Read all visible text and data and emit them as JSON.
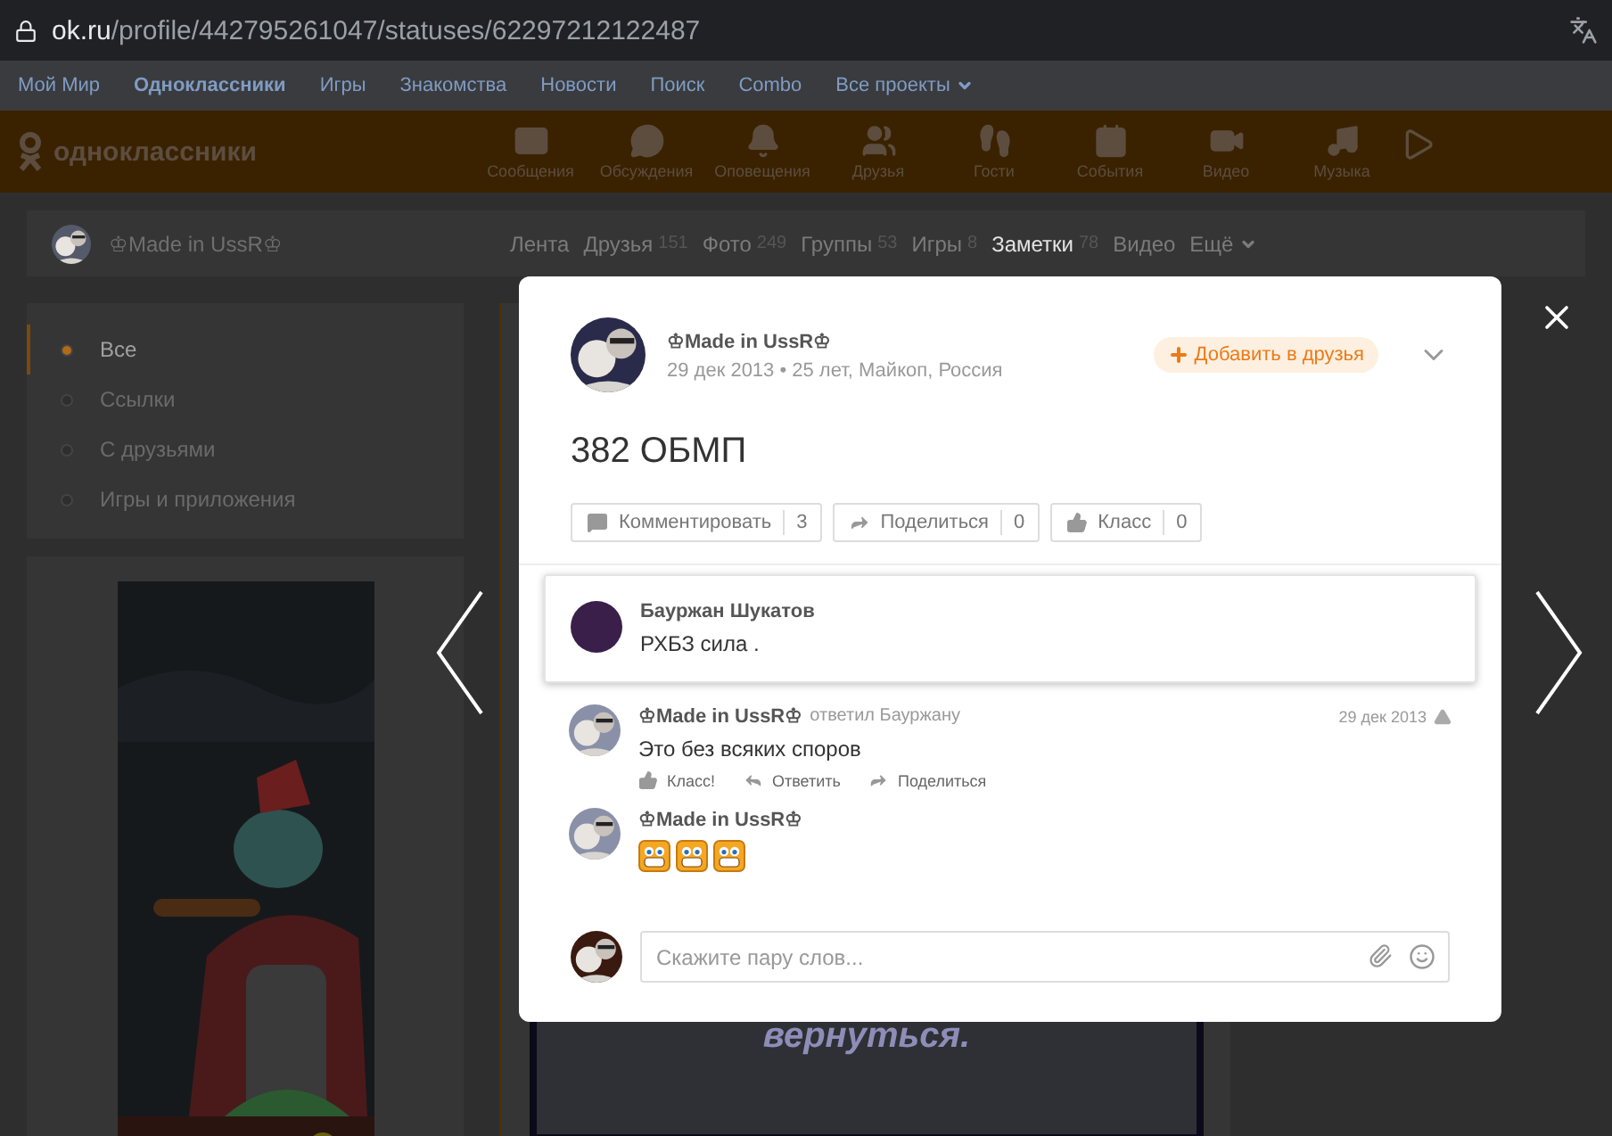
{
  "browser": {
    "host": "ok.ru",
    "path": "/profile/442795261047/statuses/62297212122487"
  },
  "portal_links": [
    {
      "label": "Мой Мир",
      "selected": false
    },
    {
      "label": "Одноклассники",
      "selected": true
    },
    {
      "label": "Игры",
      "selected": false
    },
    {
      "label": "Знакомства",
      "selected": false
    },
    {
      "label": "Новости",
      "selected": false
    },
    {
      "label": "Поиск",
      "selected": false
    },
    {
      "label": "Combo",
      "selected": false
    },
    {
      "label": "Все проекты",
      "selected": false,
      "dropdown": true
    }
  ],
  "header": {
    "logo": "одноклассники",
    "nav": [
      {
        "kind": "mail",
        "label": "Сообщения"
      },
      {
        "kind": "chat",
        "label": "Обсуждения"
      },
      {
        "kind": "bell",
        "label": "Оповещения"
      },
      {
        "kind": "users",
        "label": "Друзья"
      },
      {
        "kind": "steps",
        "label": "Гости"
      },
      {
        "kind": "events",
        "label": "События"
      },
      {
        "kind": "video",
        "label": "Видео"
      },
      {
        "kind": "music",
        "label": "Музыка"
      }
    ]
  },
  "profile": {
    "name": "♔Made in UssR♔",
    "tabs": [
      {
        "label": "Лента",
        "selected": false
      },
      {
        "label": "Друзья",
        "count": "151",
        "selected": false
      },
      {
        "label": "Фото",
        "count": "249",
        "selected": false
      },
      {
        "label": "Группы",
        "count": "53",
        "selected": false
      },
      {
        "label": "Игры",
        "count": "8",
        "selected": false
      },
      {
        "label": "Заметки",
        "count": "78",
        "selected": true
      },
      {
        "label": "Видео",
        "selected": false
      },
      {
        "label": "Ещё",
        "selected": false,
        "dropdown": true
      }
    ]
  },
  "filters": [
    {
      "label": "Все",
      "selected": true
    },
    {
      "label": "Ссылки",
      "selected": false
    },
    {
      "label": "С друзьями",
      "selected": false
    },
    {
      "label": "Игры и приложения",
      "selected": false
    }
  ],
  "post_preview": {
    "text": "вернуться."
  },
  "modal": {
    "author": "♔Made in UssR♔",
    "meta": "29 дек 2013 • 25 лет, Майкоп, Россия",
    "add_friend": "Добавить в друзья",
    "title": "382 ОБМП",
    "actions": [
      {
        "kind": "comment",
        "label": "Комментировать",
        "count": "3"
      },
      {
        "kind": "share",
        "label": "Поделиться",
        "count": "0"
      },
      {
        "kind": "like",
        "label": "Класс",
        "count": "0"
      }
    ],
    "comments": [
      {
        "author": "Бауржан Шукатов",
        "text": "РХБЗ сила .",
        "highlighted": true
      },
      {
        "author": "♔Made in UssR♔",
        "reply_to": "ответил Бауржану",
        "date": "29 дек 2013",
        "text": "Это без всяких споров",
        "highlighted": false,
        "actions": [
          {
            "kind": "like",
            "label": "Класс!"
          },
          {
            "kind": "reply",
            "label": "Ответить"
          },
          {
            "kind": "share",
            "label": "Поделиться"
          }
        ]
      },
      {
        "author": "♔Made in UssR♔",
        "highlighted": false,
        "stickers": [
          {
            "kind": "grin"
          },
          {
            "kind": "grin"
          },
          {
            "kind": "grin"
          }
        ]
      }
    ],
    "input": {
      "placeholder": "Скажите пару слов..."
    }
  }
}
